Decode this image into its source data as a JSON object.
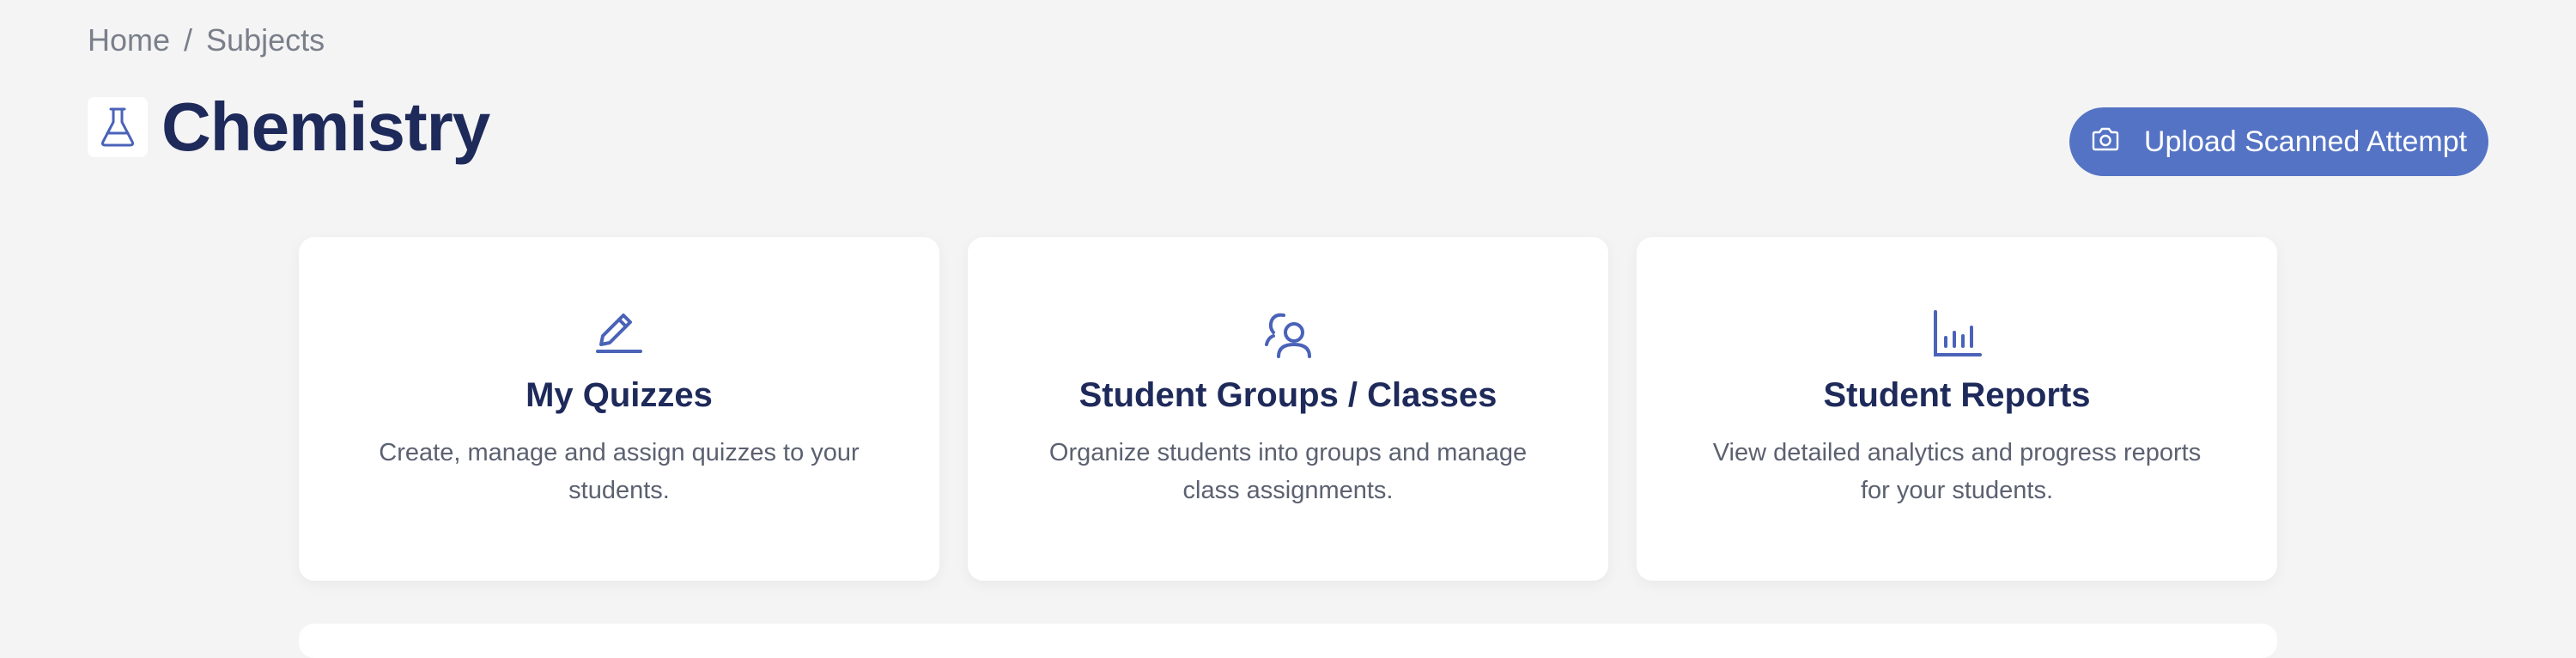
{
  "breadcrumb": {
    "home": "Home",
    "separator": "/",
    "subjects": "Subjects"
  },
  "page": {
    "title": "Chemistry",
    "icon": "flask-icon"
  },
  "upload_button": {
    "label": "Upload Scanned Attempt",
    "icon": "camera-icon"
  },
  "cards": [
    {
      "icon": "pencil-icon",
      "title": "My Quizzes",
      "description": "Create, manage and assign quizzes to your students."
    },
    {
      "icon": "users-icon",
      "title": "Student Groups / Classes",
      "description": "Organize students into groups and manage class assignments."
    },
    {
      "icon": "bar-chart-icon",
      "title": "Student Reports",
      "description": "View detailed analytics and progress reports for your students."
    }
  ],
  "colors": {
    "accent": "#5473c4",
    "title": "#1e2a5a",
    "background": "#f4f4f5"
  }
}
